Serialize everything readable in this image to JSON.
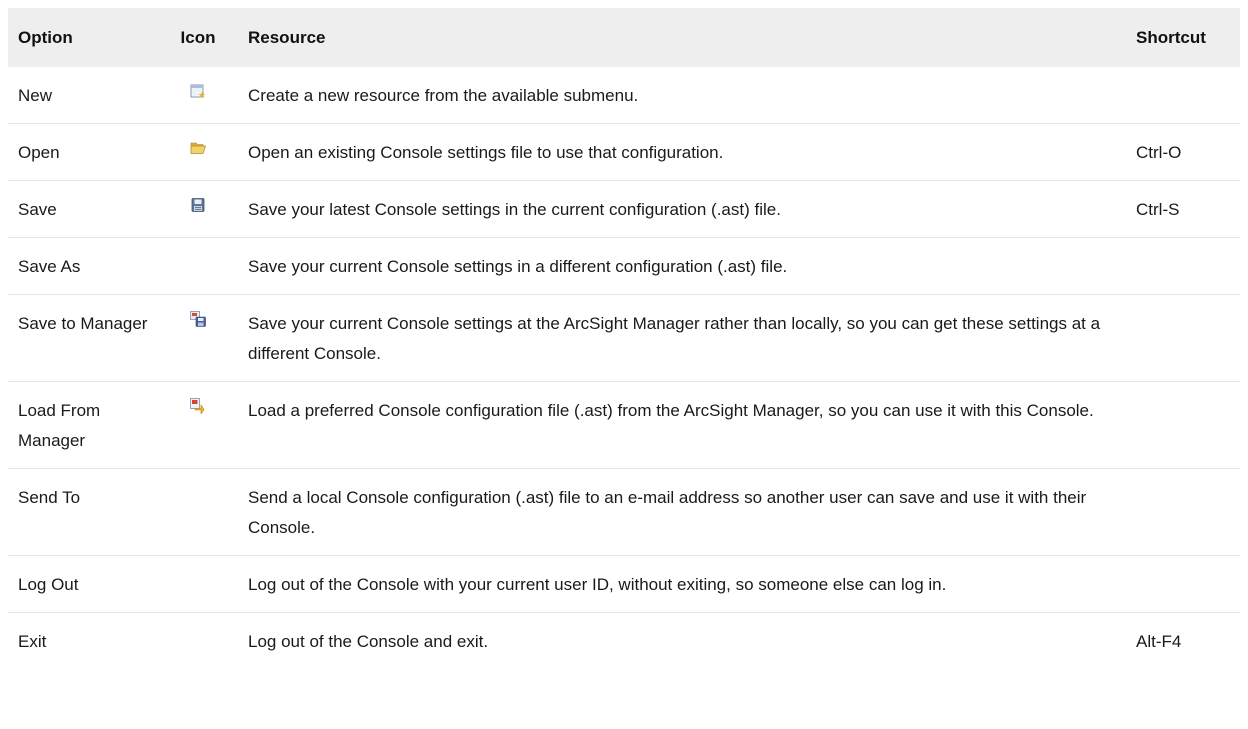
{
  "table": {
    "headers": {
      "option": "Option",
      "icon": "Icon",
      "resource": "Resource",
      "shortcut": "Shortcut"
    },
    "rows": [
      {
        "option": "New",
        "icon": "new-resource-icon",
        "resource": "Create a new resource from the available submenu.",
        "shortcut": ""
      },
      {
        "option": "Open",
        "icon": "folder-open-icon",
        "resource": "Open an existing Console settings file to use that configuration.",
        "shortcut": "Ctrl-O"
      },
      {
        "option": "Save",
        "icon": "floppy-disk-icon",
        "resource": "Save your latest Console settings in the current configuration (.ast) file.",
        "shortcut": "Ctrl-S"
      },
      {
        "option": "Save As",
        "icon": "",
        "resource": "Save your current Console settings in a different configuration (.ast) file.",
        "shortcut": ""
      },
      {
        "option": "Save to Manager",
        "icon": "save-to-manager-icon",
        "resource": "Save your current Console settings at the ArcSight Manager rather than locally, so you can get these settings at a different Console.",
        "shortcut": ""
      },
      {
        "option": "Load From Manager",
        "icon": "load-from-manager-icon",
        "resource": "Load a preferred Console configuration file (.ast) from the ArcSight Manager, so you can use it with this Console.",
        "shortcut": ""
      },
      {
        "option": "Send To",
        "icon": "",
        "resource": "Send a local Console configuration (.ast) file to an e-mail address so another user can save and use it with their Console.",
        "shortcut": ""
      },
      {
        "option": "Log Out",
        "icon": "",
        "resource": "Log out of the Console with your current user ID, without exiting, so someone else can log in.",
        "shortcut": ""
      },
      {
        "option": "Exit",
        "icon": "",
        "resource": "Log out of the Console and exit.",
        "shortcut": "Alt-F4"
      }
    ]
  },
  "colors": {
    "header_background": "#eeeeee",
    "row_divider": "#e4e4e4"
  }
}
